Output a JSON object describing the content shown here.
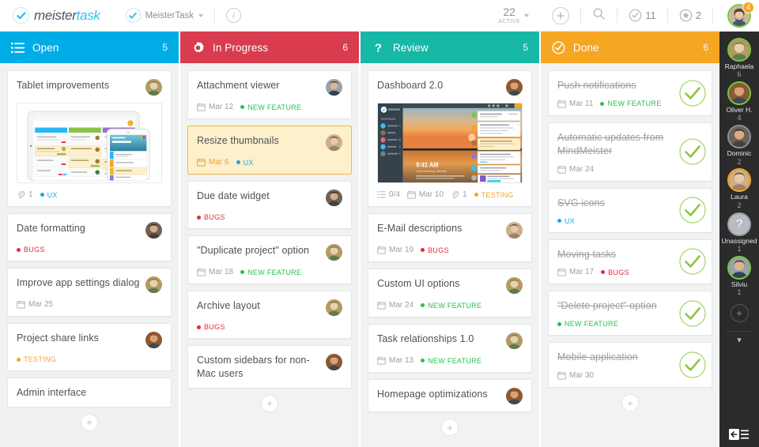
{
  "header": {
    "brand_part1": "meister",
    "brand_part2": "task",
    "project_name": "MeisterTask",
    "info_label": "i",
    "active_number": "22",
    "active_label": "ACTIVE",
    "add_label": "+",
    "search_icon": "search-icon",
    "completed_count": "11",
    "starred_count": "2",
    "avatar_badge": "4"
  },
  "columns": [
    {
      "id": "open",
      "title": "Open",
      "count": "5",
      "color": "#00ace6",
      "icon": "list-icon",
      "add_label": "+",
      "cards": [
        {
          "title": "Tablet improvements",
          "avatar": "raphaela",
          "thumb": "tablet",
          "done": false,
          "highlight": false,
          "meta": [
            {
              "type": "attachment",
              "text": "1"
            }
          ],
          "tags": [
            {
              "label": "UX",
              "color": "#1fa8e0"
            }
          ]
        },
        {
          "title": "Date formatting",
          "avatar": "dominic",
          "done": false,
          "highlight": false,
          "meta": [],
          "tags": [
            {
              "label": "BUGS",
              "color": "#e8293f"
            }
          ]
        },
        {
          "title": "Improve app settings dialog",
          "avatar": "raphaela",
          "done": false,
          "highlight": false,
          "meta": [
            {
              "type": "date",
              "text": "Mar 25"
            }
          ],
          "tags": []
        },
        {
          "title": "Project share links",
          "avatar": "oliver",
          "done": false,
          "highlight": false,
          "meta": [],
          "tags": [
            {
              "label": "TESTING",
              "color": "#f5a623"
            }
          ]
        },
        {
          "title": "Admin interface",
          "avatar": "none",
          "done": false,
          "highlight": false,
          "meta": [],
          "tags": []
        }
      ]
    },
    {
      "id": "in-progress",
      "title": "In Progress",
      "count": "6",
      "color": "#d83c4e",
      "icon": "gear-icon",
      "add_label": "+",
      "cards": [
        {
          "title": "Attachment viewer",
          "avatar": "silviu",
          "done": false,
          "highlight": false,
          "meta": [
            {
              "type": "date",
              "text": "Mar 12"
            }
          ],
          "tags": [
            {
              "label": "NEW FEATURE",
              "color": "#27c24c"
            }
          ]
        },
        {
          "title": "Resize thumbnails",
          "avatar": "laura",
          "done": false,
          "highlight": true,
          "meta": [
            {
              "type": "date",
              "text": "Mar 6",
              "overdue": true
            }
          ],
          "tags": [
            {
              "label": "UX",
              "color": "#1fa8e0"
            }
          ]
        },
        {
          "title": "Due date widget",
          "avatar": "dominic",
          "done": false,
          "highlight": false,
          "meta": [],
          "tags": [
            {
              "label": "BUGS",
              "color": "#e8293f"
            }
          ]
        },
        {
          "title": "\"Duplicate project\" option",
          "avatar": "raphaela",
          "done": false,
          "highlight": false,
          "meta": [
            {
              "type": "date",
              "text": "Mar 18"
            }
          ],
          "tags": [
            {
              "label": "NEW FEATURE",
              "color": "#27c24c"
            }
          ]
        },
        {
          "title": "Archive layout",
          "avatar": "raphaela",
          "done": false,
          "highlight": false,
          "meta": [],
          "tags": [
            {
              "label": "BUGS",
              "color": "#e8293f"
            }
          ]
        },
        {
          "title": "Custom sidebars for non-Mac users",
          "avatar": "oliver",
          "done": false,
          "highlight": false,
          "meta": [],
          "tags": []
        }
      ]
    },
    {
      "id": "review",
      "title": "Review",
      "count": "5",
      "color": "#17b8a6",
      "icon": "question-icon",
      "add_label": "+",
      "cards": [
        {
          "title": "Dashboard 2.0",
          "avatar": "oliver",
          "thumb": "dashboard",
          "done": false,
          "highlight": false,
          "meta": [
            {
              "type": "checklist",
              "text": "0/4"
            },
            {
              "type": "date",
              "text": "Mar 10"
            },
            {
              "type": "attachment",
              "text": "1"
            }
          ],
          "tags": [
            {
              "label": "TESTING",
              "color": "#f5a623"
            }
          ]
        },
        {
          "title": "E-Mail descriptions",
          "avatar": "laura",
          "done": false,
          "highlight": false,
          "meta": [
            {
              "type": "date",
              "text": "Mar 19"
            }
          ],
          "tags": [
            {
              "label": "BUGS",
              "color": "#e8293f"
            }
          ]
        },
        {
          "title": "Custom UI options",
          "avatar": "raphaela",
          "done": false,
          "highlight": false,
          "meta": [
            {
              "type": "date",
              "text": "Mar 24"
            }
          ],
          "tags": [
            {
              "label": "NEW FEATURE",
              "color": "#27c24c"
            }
          ]
        },
        {
          "title": "Task relationships 1.0",
          "avatar": "raphaela",
          "done": false,
          "highlight": false,
          "meta": [
            {
              "type": "date",
              "text": "Mar 13"
            }
          ],
          "tags": [
            {
              "label": "NEW FEATURE",
              "color": "#27c24c"
            }
          ]
        },
        {
          "title": "Homepage optimizations",
          "avatar": "oliver",
          "done": false,
          "highlight": false,
          "meta": [],
          "tags": []
        }
      ]
    },
    {
      "id": "done",
      "title": "Done",
      "count": "6",
      "color": "#f5a623",
      "icon": "check-circle-icon",
      "add_label": "+",
      "cards": [
        {
          "title": "Push notifications",
          "avatar": "none",
          "done": true,
          "highlight": false,
          "meta": [
            {
              "type": "date",
              "text": "Mar 11"
            }
          ],
          "tags": [
            {
              "label": "NEW FEATURE",
              "color": "#27c24c"
            }
          ]
        },
        {
          "title": "Automatic updates from MindMeister",
          "avatar": "none",
          "done": true,
          "highlight": false,
          "meta": [
            {
              "type": "date",
              "text": "Mar 24"
            }
          ],
          "tags": []
        },
        {
          "title": "SVG icons",
          "avatar": "none",
          "done": true,
          "highlight": false,
          "meta": [],
          "tags": [
            {
              "label": "UX",
              "color": "#1fa8e0"
            }
          ]
        },
        {
          "title": "Moving tasks",
          "avatar": "none",
          "done": true,
          "highlight": false,
          "meta": [
            {
              "type": "date",
              "text": "Mar 17"
            }
          ],
          "tags": [
            {
              "label": "BUGS",
              "color": "#e8293f"
            }
          ]
        },
        {
          "title": "\"Delete project\" option",
          "avatar": "none",
          "done": true,
          "highlight": false,
          "meta": [],
          "tags": [
            {
              "label": "NEW FEATURE",
              "color": "#27c24c"
            }
          ]
        },
        {
          "title": "Mobile application",
          "avatar": "none",
          "done": true,
          "highlight": false,
          "meta": [
            {
              "type": "date",
              "text": "Mar 30"
            }
          ],
          "tags": []
        }
      ]
    }
  ],
  "sidebar": {
    "members": [
      {
        "name": "Raphaela",
        "count": "6",
        "ring": "green",
        "avatar": "raphaela"
      },
      {
        "name": "Oliver H.",
        "count": "4",
        "ring": "green",
        "avatar": "oliver"
      },
      {
        "name": "Dominic",
        "count": "2",
        "ring": "gray",
        "avatar": "dominic"
      },
      {
        "name": "Laura",
        "count": "2",
        "ring": "orange",
        "avatar": "laura"
      },
      {
        "name": "Unassigned",
        "count": "1",
        "ring": "gray",
        "avatar": "unassigned"
      },
      {
        "name": "Silviu",
        "count": "1",
        "ring": "green",
        "avatar": "silviu"
      }
    ],
    "add_label": "+",
    "chevron": "▾",
    "collapse_icon": "collapse-sidebar-icon"
  }
}
